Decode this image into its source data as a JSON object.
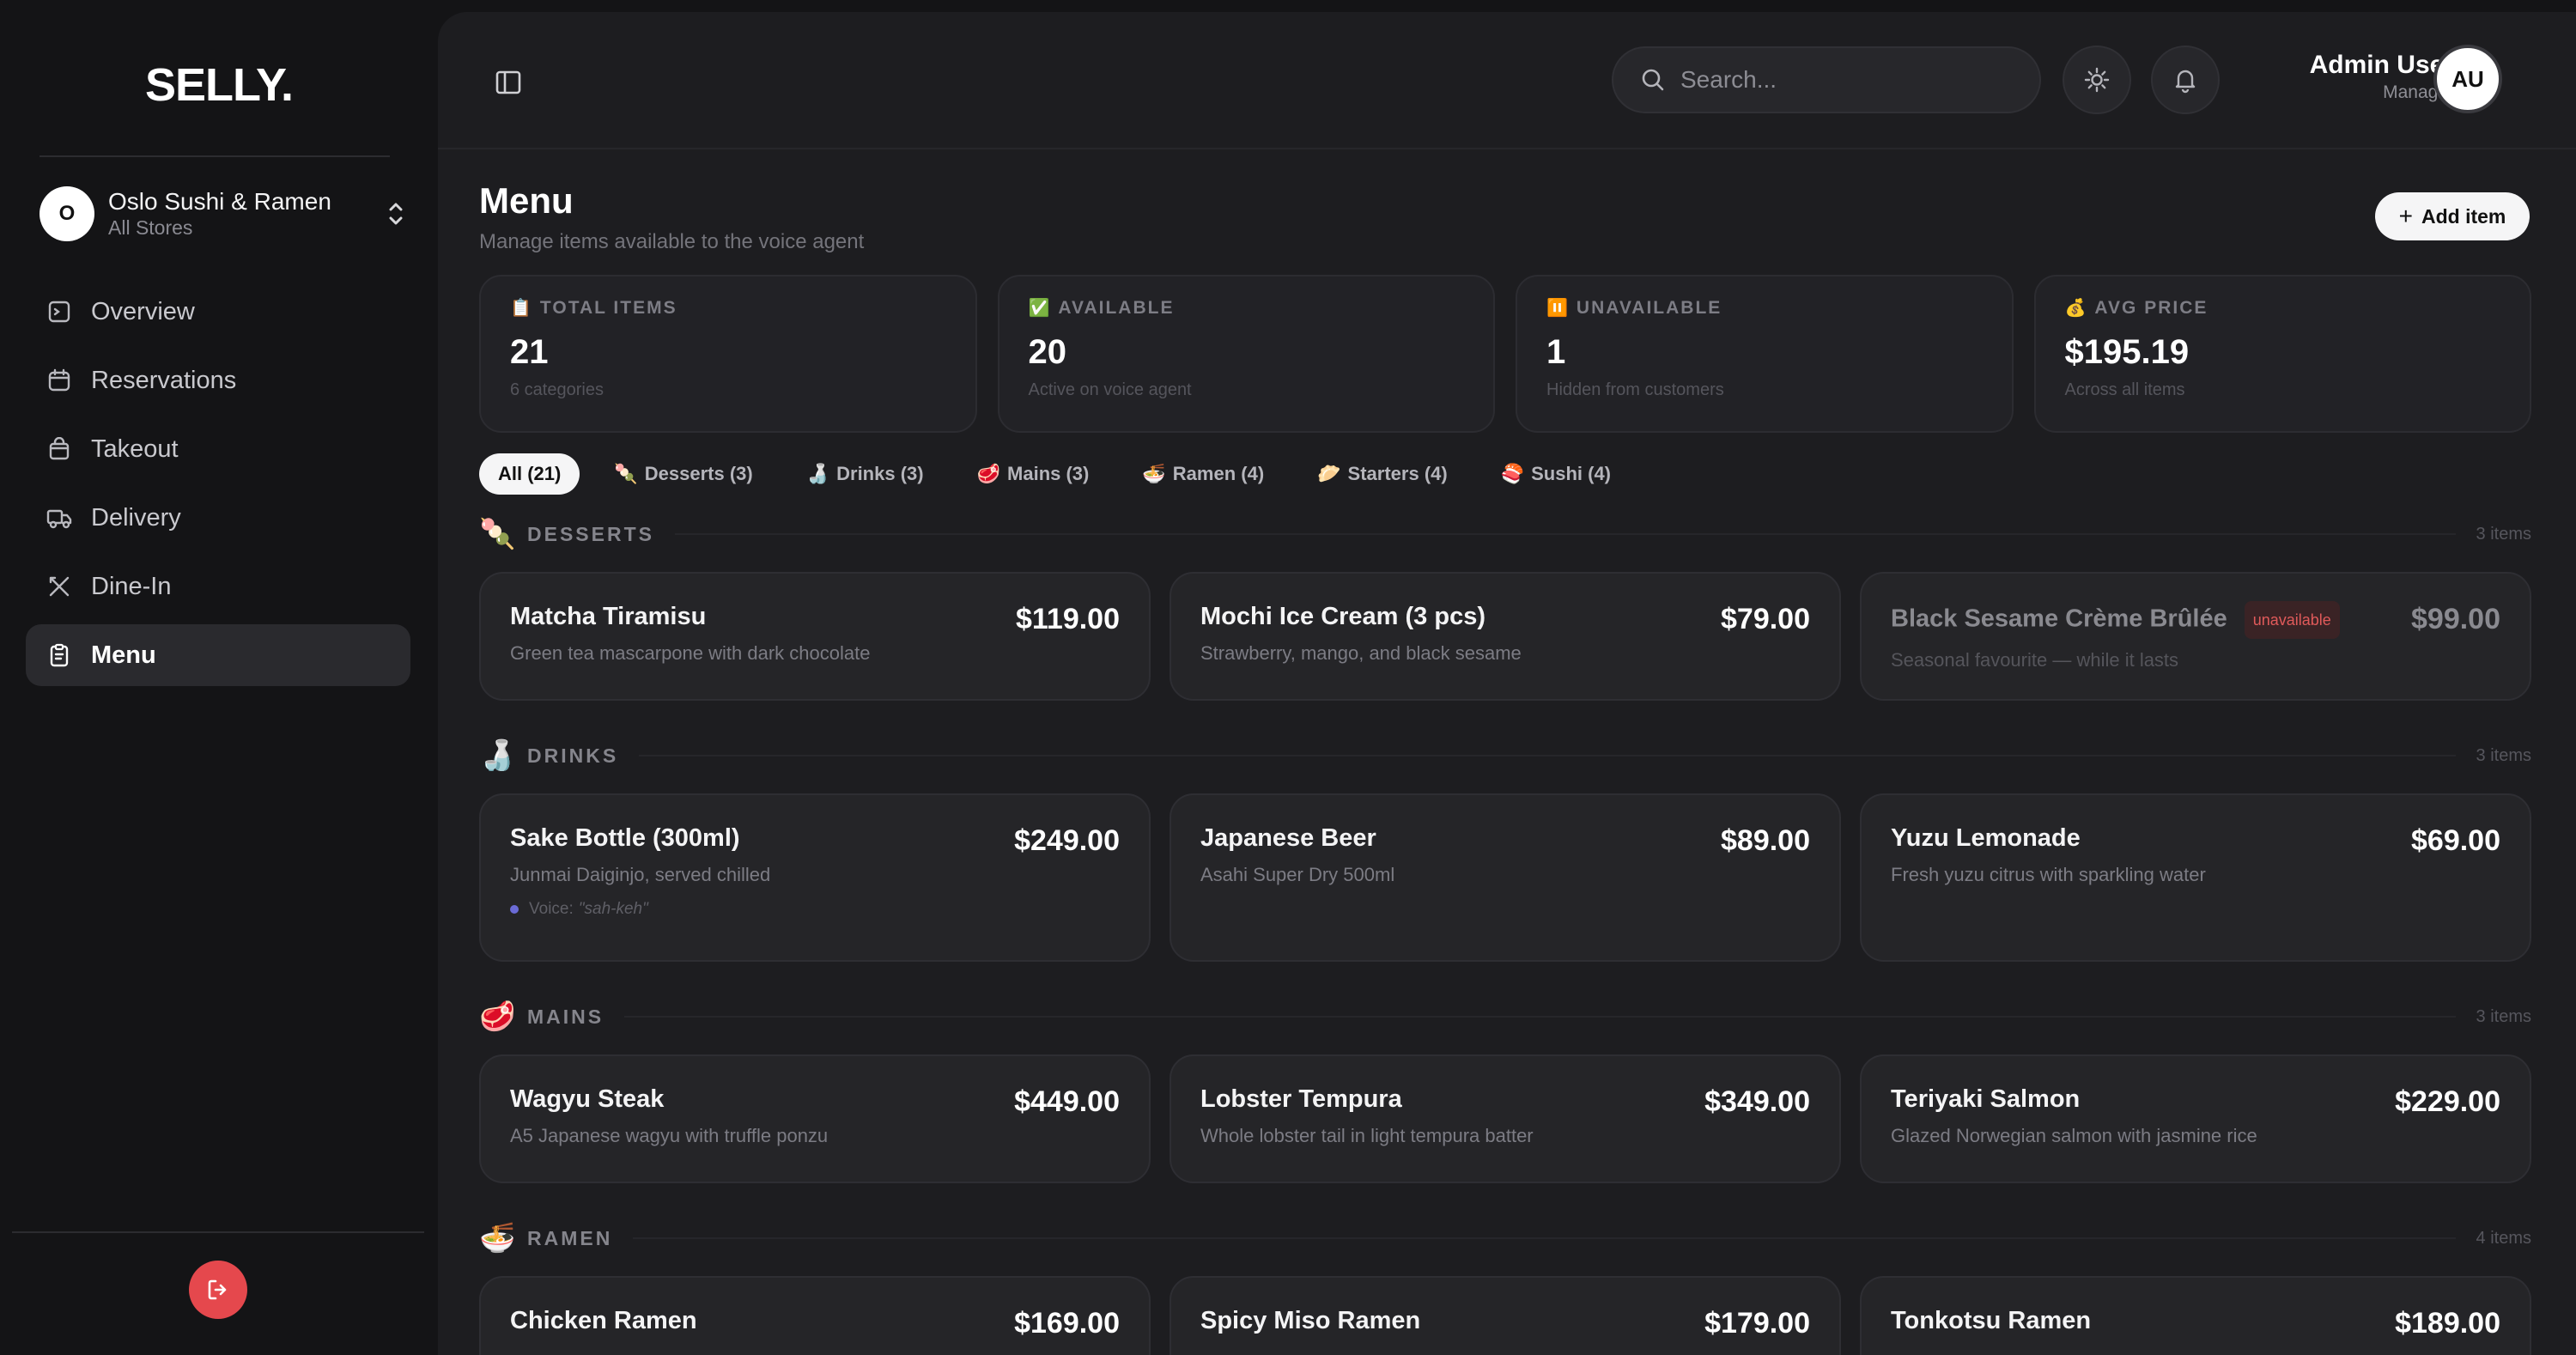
{
  "brand": "SELLY.",
  "store": {
    "initial": "O",
    "name": "Oslo Sushi & Ramen",
    "sub": "All Stores"
  },
  "nav": [
    {
      "label": "Overview",
      "icon": "overview-icon"
    },
    {
      "label": "Reservations",
      "icon": "calendar-icon"
    },
    {
      "label": "Takeout",
      "icon": "bag-icon"
    },
    {
      "label": "Delivery",
      "icon": "truck-icon"
    },
    {
      "label": "Dine-In",
      "icon": "utensils-icon"
    },
    {
      "label": "Menu",
      "icon": "clipboard-icon",
      "active": true
    }
  ],
  "header": {
    "search_placeholder": "Search...",
    "user_name": "Admin User",
    "user_role": "Manager",
    "user_initials": "AU"
  },
  "page": {
    "title": "Menu",
    "subtitle": "Manage items available to the voice agent",
    "add_button": "Add item"
  },
  "stats": [
    {
      "emoji": "📋",
      "label": "TOTAL ITEMS",
      "value": "21",
      "foot": "6 categories"
    },
    {
      "emoji": "✅",
      "label": "AVAILABLE",
      "value": "20",
      "foot": "Active on voice agent"
    },
    {
      "emoji": "⏸️",
      "label": "UNAVAILABLE",
      "value": "1",
      "foot": "Hidden from customers"
    },
    {
      "emoji": "💰",
      "label": "AVG PRICE",
      "value": "$195.19",
      "foot": "Across all items"
    }
  ],
  "filters": [
    {
      "emoji": "",
      "label": "All (21)",
      "active": true
    },
    {
      "emoji": "🍡",
      "label": "Desserts (3)"
    },
    {
      "emoji": "🍶",
      "label": "Drinks (3)"
    },
    {
      "emoji": "🥩",
      "label": "Mains (3)"
    },
    {
      "emoji": "🍜",
      "label": "Ramen (4)"
    },
    {
      "emoji": "🥟",
      "label": "Starters (4)"
    },
    {
      "emoji": "🍣",
      "label": "Sushi (4)"
    }
  ],
  "sections": [
    {
      "emoji": "🍡",
      "title": "DESSERTS",
      "count": "3 items",
      "items": [
        {
          "name": "Matcha Tiramisu",
          "desc": "Green tea mascarpone with dark chocolate",
          "price": "$119.00"
        },
        {
          "name": "Mochi Ice Cream (3 pcs)",
          "desc": "Strawberry, mango, and black sesame",
          "price": "$79.00"
        },
        {
          "name": "Black Sesame Crème Brûlée",
          "desc": "Seasonal favourite — while it lasts",
          "price": "$99.00",
          "badge": "unavailable"
        }
      ]
    },
    {
      "emoji": "🍶",
      "title": "DRINKS",
      "count": "3 items",
      "items": [
        {
          "name": "Sake Bottle (300ml)",
          "desc": "Junmai Daiginjo, served chilled",
          "price": "$249.00",
          "voice_label": "Voice:",
          "voice_value": "\"sah-keh\""
        },
        {
          "name": "Japanese Beer",
          "desc": "Asahi Super Dry 500ml",
          "price": "$89.00"
        },
        {
          "name": "Yuzu Lemonade",
          "desc": "Fresh yuzu citrus with sparkling water",
          "price": "$69.00"
        }
      ]
    },
    {
      "emoji": "🥩",
      "title": "MAINS",
      "count": "3 items",
      "items": [
        {
          "name": "Wagyu Steak",
          "desc": "A5 Japanese wagyu with truffle ponzu",
          "price": "$449.00"
        },
        {
          "name": "Lobster Tempura",
          "desc": "Whole lobster tail in light tempura batter",
          "price": "$349.00"
        },
        {
          "name": "Teriyaki Salmon",
          "desc": "Glazed Norwegian salmon with jasmine rice",
          "price": "$229.00"
        }
      ]
    },
    {
      "emoji": "🍜",
      "title": "RAMEN",
      "count": "4 items",
      "items": [
        {
          "name": "Chicken Ramen",
          "desc": "",
          "price": "$169.00"
        },
        {
          "name": "Spicy Miso Ramen",
          "desc": "",
          "price": "$179.00"
        },
        {
          "name": "Tonkotsu Ramen",
          "desc": "",
          "price": "$189.00"
        }
      ]
    }
  ]
}
